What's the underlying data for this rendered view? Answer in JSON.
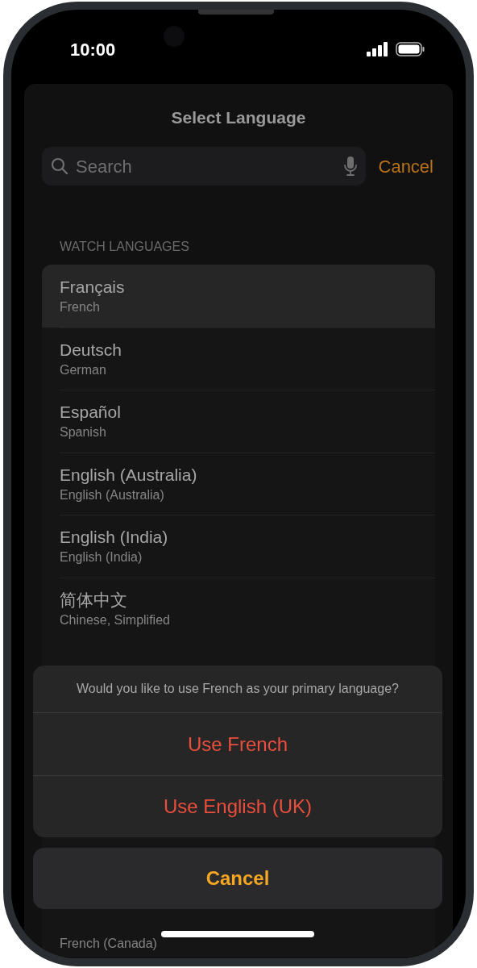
{
  "status_bar": {
    "time": "10:00"
  },
  "title": "Select Language",
  "search": {
    "placeholder": "Search",
    "cancel": "Cancel"
  },
  "section_header": "WATCH LANGUAGES",
  "languages": [
    {
      "name": "Français",
      "english": "French",
      "selected": true
    },
    {
      "name": "Deutsch",
      "english": "German",
      "selected": false
    },
    {
      "name": "Español",
      "english": "Spanish",
      "selected": false
    },
    {
      "name": "English (Australia)",
      "english": "English (Australia)",
      "selected": false
    },
    {
      "name": "English (India)",
      "english": "English (India)",
      "selected": false
    },
    {
      "name": "简体中文",
      "english": "Chinese, Simplified",
      "selected": false
    },
    {
      "english": "French (Canada)",
      "selected": false
    }
  ],
  "action_sheet": {
    "message": "Would you like to use French as your primary language?",
    "actions": [
      "Use French",
      "Use English (UK)"
    ],
    "cancel": "Cancel"
  }
}
